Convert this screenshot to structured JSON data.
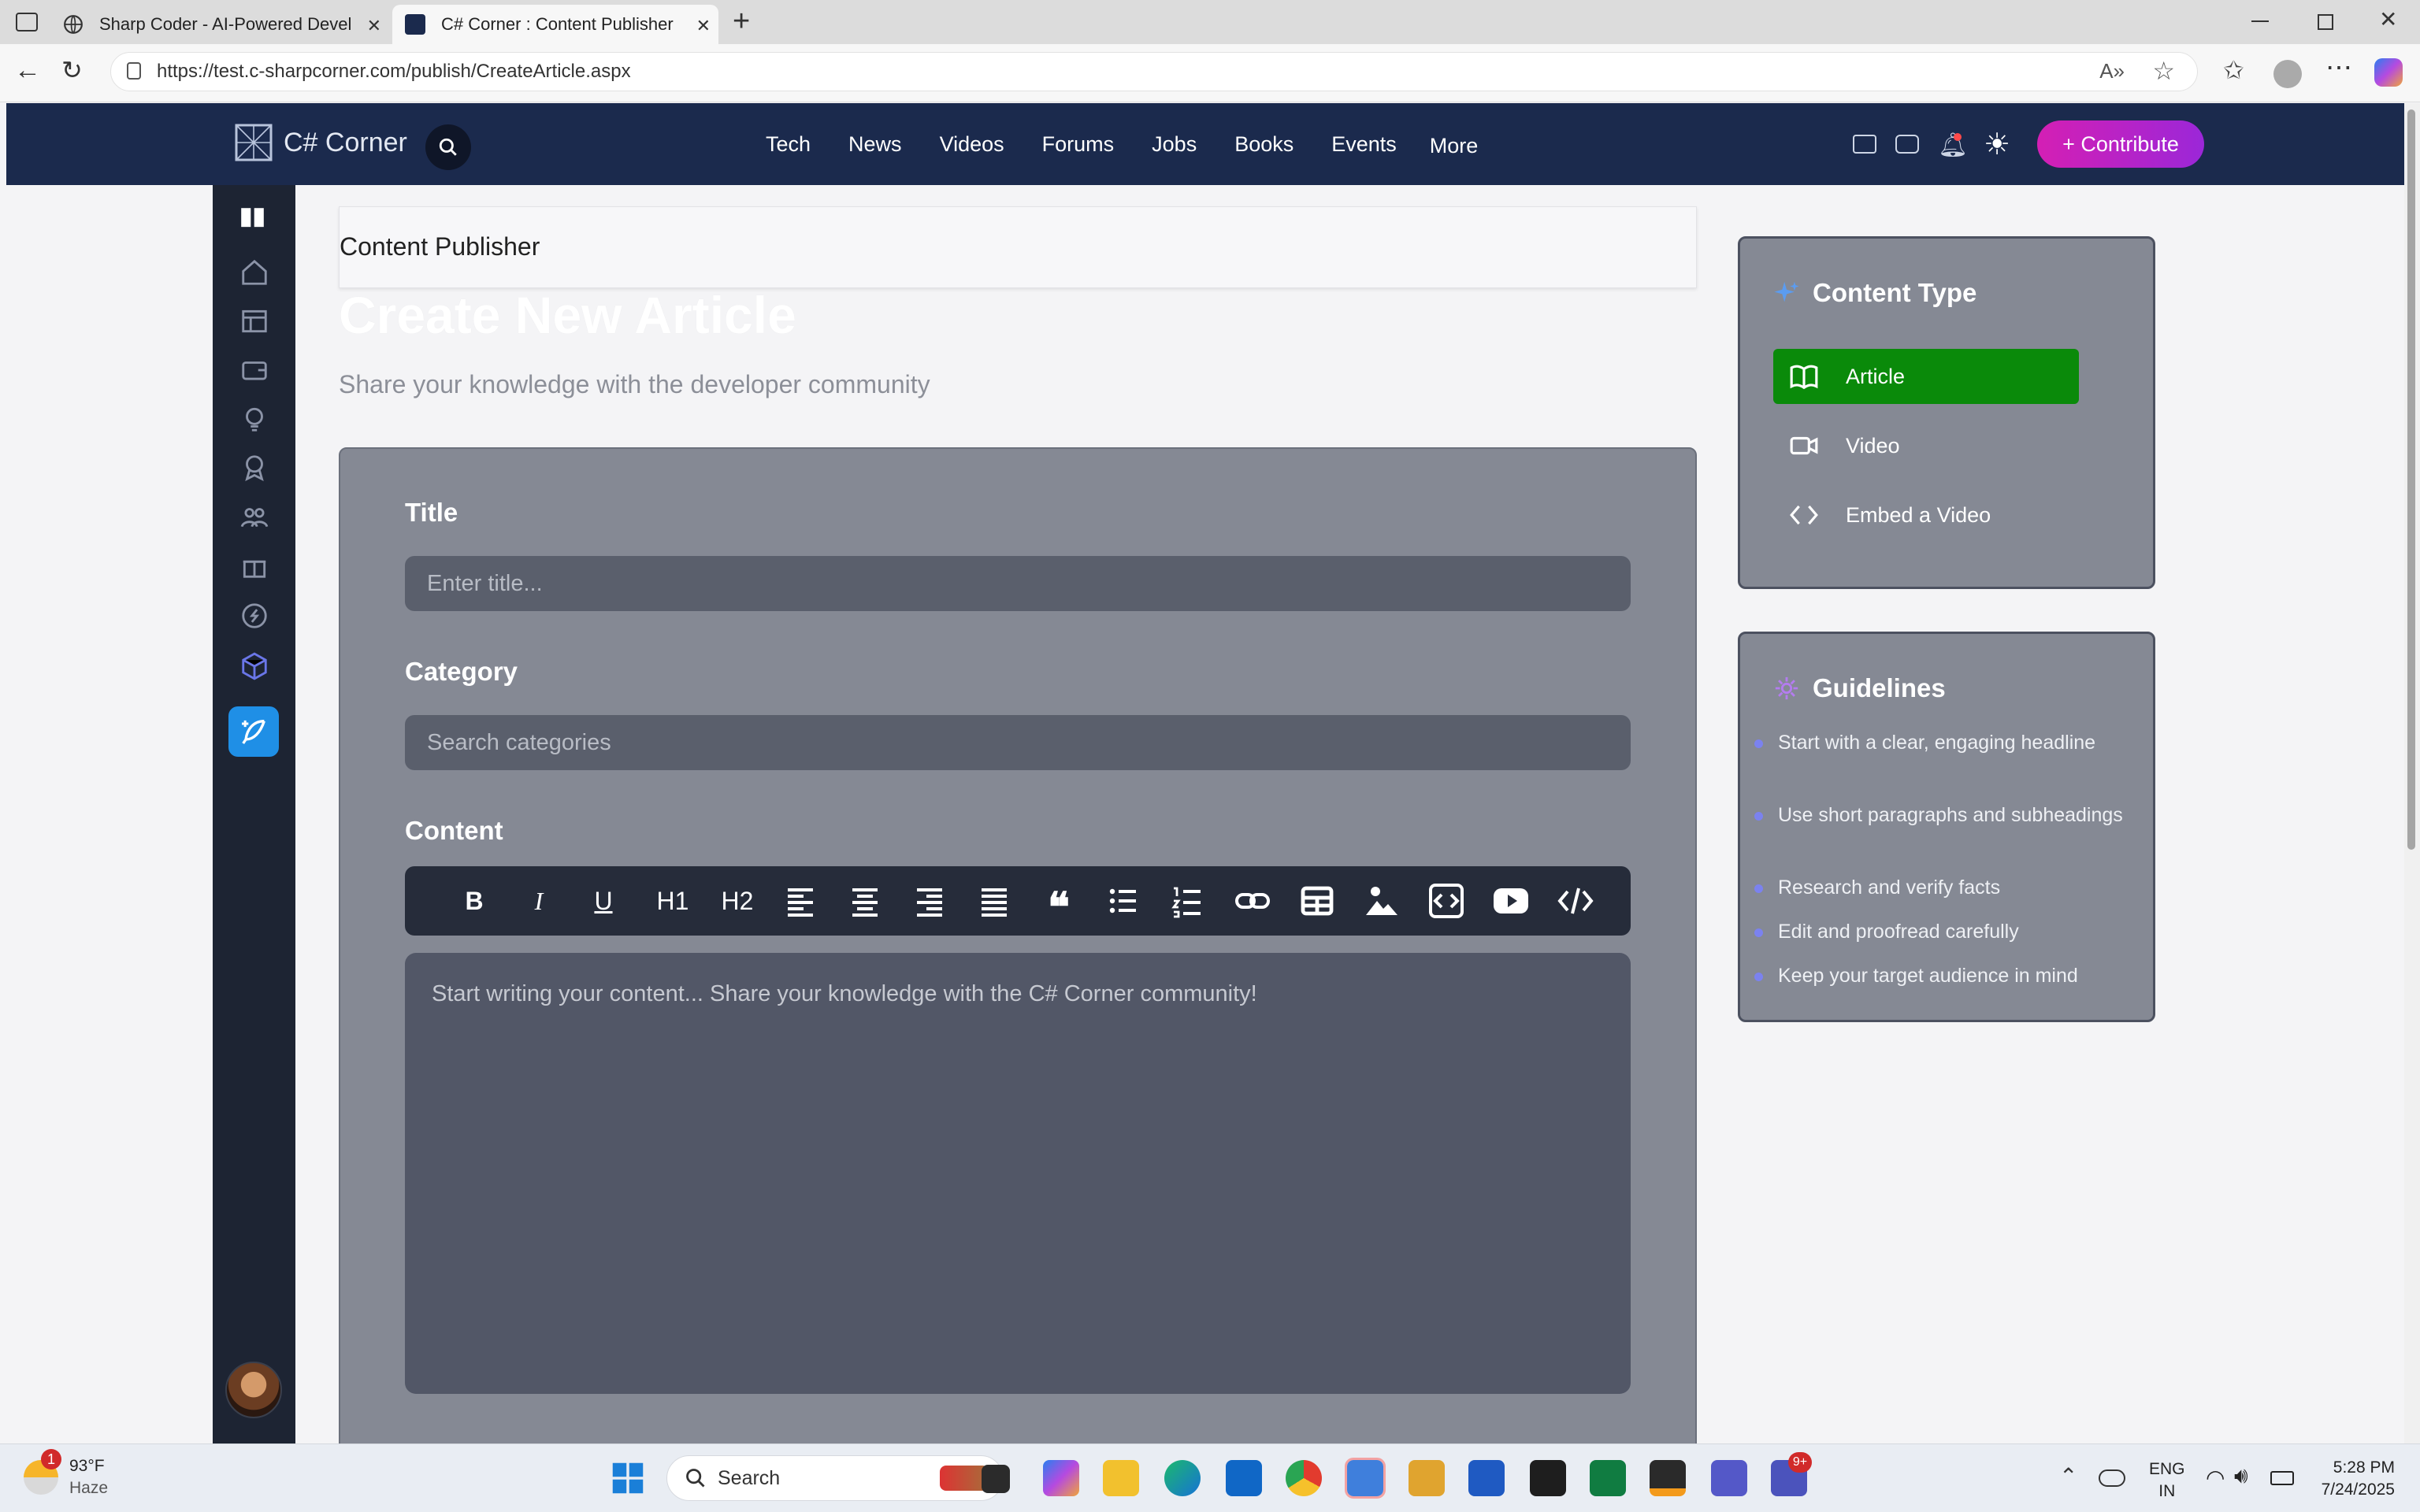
{
  "browser": {
    "tabs": [
      {
        "title": "Sharp Coder - AI-Powered Develo",
        "active": false
      },
      {
        "title": "C# Corner : Content Publisher",
        "active": true
      }
    ],
    "url": "https://test.c-sharpcorner.com/publish/CreateArticle.aspx"
  },
  "site": {
    "logo_text": "C# Corner",
    "nav": [
      "Tech",
      "News",
      "Videos",
      "Forums",
      "Jobs",
      "Books",
      "Events",
      "More"
    ],
    "contribute_label": "+ Contribute"
  },
  "page": {
    "breadcrumb": "Content Publisher",
    "heading": "Create New Article",
    "subheading": "Share your knowledge with the developer community"
  },
  "form": {
    "title_label": "Title",
    "title_placeholder": "Enter title...",
    "category_label": "Category",
    "category_placeholder": "Search categories",
    "content_label": "Content",
    "editor_placeholder": "Start writing your content... Share your knowledge with the C# Corner community!",
    "toolbar": [
      "B",
      "I",
      "U",
      "H1",
      "H2"
    ]
  },
  "content_type": {
    "title": "Content Type",
    "options": [
      {
        "label": "Article",
        "selected": true,
        "icon": "book-icon"
      },
      {
        "label": "Video",
        "selected": false,
        "icon": "video-camera-icon"
      },
      {
        "label": "Embed a Video",
        "selected": false,
        "icon": "code-brackets-icon"
      }
    ],
    "accent": "#0a8a0a"
  },
  "guidelines": {
    "title": "Guidelines",
    "items": [
      "Start with a clear, engaging headline",
      "Use short paragraphs and subheadings",
      "Research and verify facts",
      "Edit and proofread carefully",
      "Keep your target audience in mind"
    ]
  },
  "taskbar": {
    "weather_temp": "93°F",
    "weather_desc": "Haze",
    "weather_badge": "1",
    "search_label": "Search",
    "lang_top": "ENG",
    "lang_bottom": "IN",
    "time": "5:28 PM",
    "date": "7/24/2025",
    "teams_badge": "9+"
  }
}
